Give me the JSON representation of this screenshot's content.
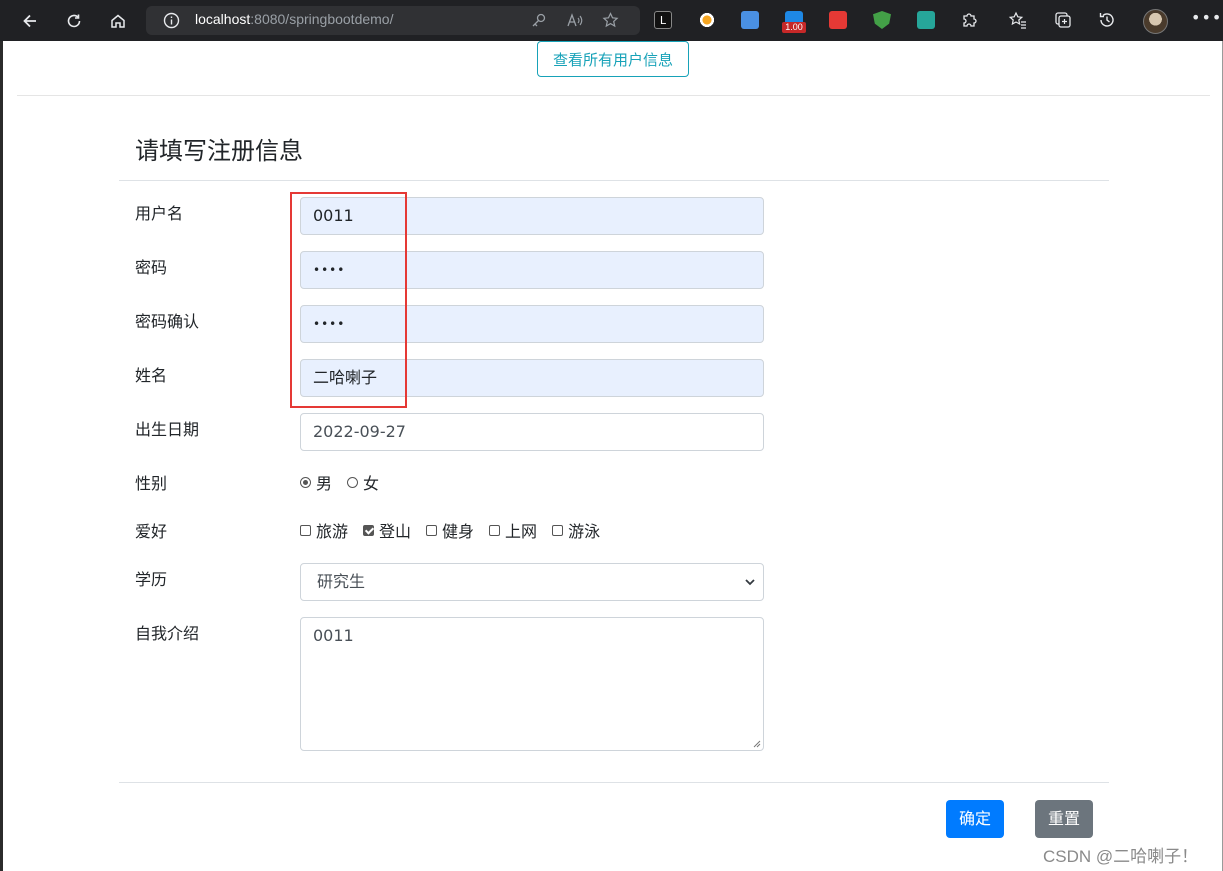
{
  "browser": {
    "url_host": "localhost",
    "url_rest": ":8080/springbootdemo/",
    "extension_badge": "1.00",
    "icons": [
      "back-icon",
      "refresh-icon",
      "home-icon",
      "info-icon",
      "key-icon",
      "read-aloud-icon",
      "favorite-add-icon",
      "extension-icons",
      "puzzle-icon",
      "favorites-icon",
      "collections-icon",
      "history-icon",
      "profile-avatar",
      "more-icon"
    ]
  },
  "page": {
    "top_button": "查看所有用户信息",
    "form_title": "请填写注册信息",
    "fields": {
      "username": {
        "label": "用户名",
        "value": "0011"
      },
      "password": {
        "label": "密码",
        "value": "••••"
      },
      "password_confirm": {
        "label": "密码确认",
        "value": "••••"
      },
      "name": {
        "label": "姓名",
        "value": "二哈喇子"
      },
      "birthday": {
        "label": "出生日期",
        "value": "2022-09-27"
      },
      "gender": {
        "label": "性别",
        "options": [
          "男",
          "女"
        ],
        "selected": "男"
      },
      "hobbies": {
        "label": "爱好",
        "options": [
          "旅游",
          "登山",
          "健身",
          "上网",
          "游泳"
        ],
        "checked": [
          "登山"
        ]
      },
      "education": {
        "label": "学历",
        "value": "研究生"
      },
      "intro": {
        "label": "自我介绍",
        "value": "0011"
      }
    },
    "submit_label": "确定",
    "reset_label": "重置",
    "watermark": "CSDN @二哈喇子！",
    "colors": {
      "autofill": "#e8f0fe",
      "primary": "#007bff",
      "secondary": "#6c757d",
      "info": "#17a2b8",
      "highlight": "#e53935"
    }
  }
}
